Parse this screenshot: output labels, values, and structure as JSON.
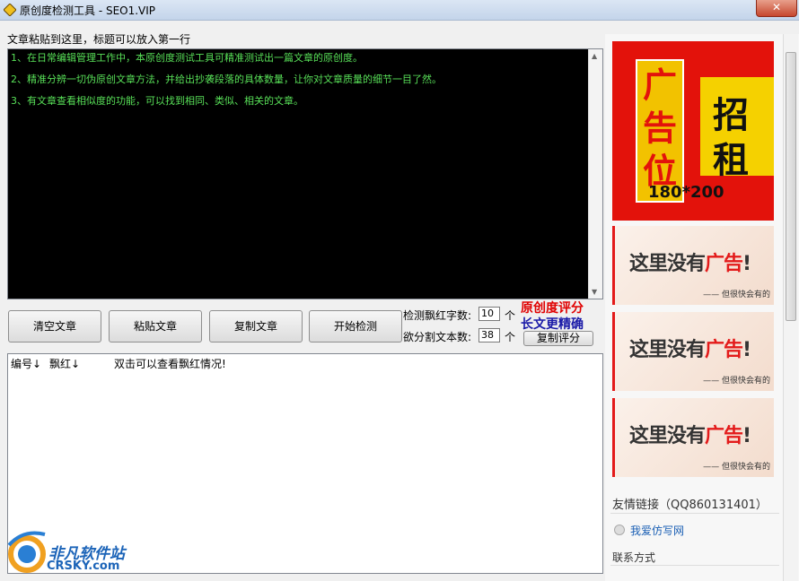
{
  "window": {
    "title": "原创度检测工具 - SEO1.VIP",
    "close_label": "✕"
  },
  "paste_hint": "文章粘贴到这里，标题可以放入第一行",
  "editor": {
    "lines": [
      "1、在日常编辑管理工作中，本原创度测试工具可精准测试出一篇文章的原创度。",
      "2、精准分辨一切伪原创文章方法，并给出抄袭段落的具体数量，让你对文章质量的细节一目了然。",
      "3、有文章查看相似度的功能，可以找到相同、类似、相关的文章。"
    ]
  },
  "buttons": {
    "clear": "清空文章",
    "paste": "粘贴文章",
    "copy": "复制文章",
    "start": "开始检测",
    "copy_score": "复制评分"
  },
  "settings": {
    "red_label": "检测飘红字数:",
    "red_value": "10",
    "red_unit": "个",
    "split_label": "欲分割文本数:",
    "split_value": "38",
    "split_unit": "个"
  },
  "score": {
    "title": "原创度评分",
    "subtitle": "长文更精确"
  },
  "results": {
    "col_no": "编号↓",
    "col_red": "飘红↓",
    "hint": "双击可以查看飘红情况!"
  },
  "ads": {
    "main": {
      "c1": "广",
      "c2": "告",
      "c3": "位",
      "c4": "招",
      "c5": "租",
      "size": "180*200"
    },
    "small_main": "这里没有",
    "small_red": "广告",
    "small_mark": "!",
    "small_sub": "—— 但很快会有的"
  },
  "sidebar": {
    "friend_links": "友情链接（QQ860131401）",
    "link1": "我爱仿写网",
    "contact": "联系方式"
  },
  "watermark": {
    "name": "非凡软件站",
    "url": "CRSKY.com"
  },
  "colors": {
    "editor_bg": "#000000",
    "editor_text": "#58e058",
    "score_red": "#e00000",
    "score_blue": "#1a1aa8"
  }
}
